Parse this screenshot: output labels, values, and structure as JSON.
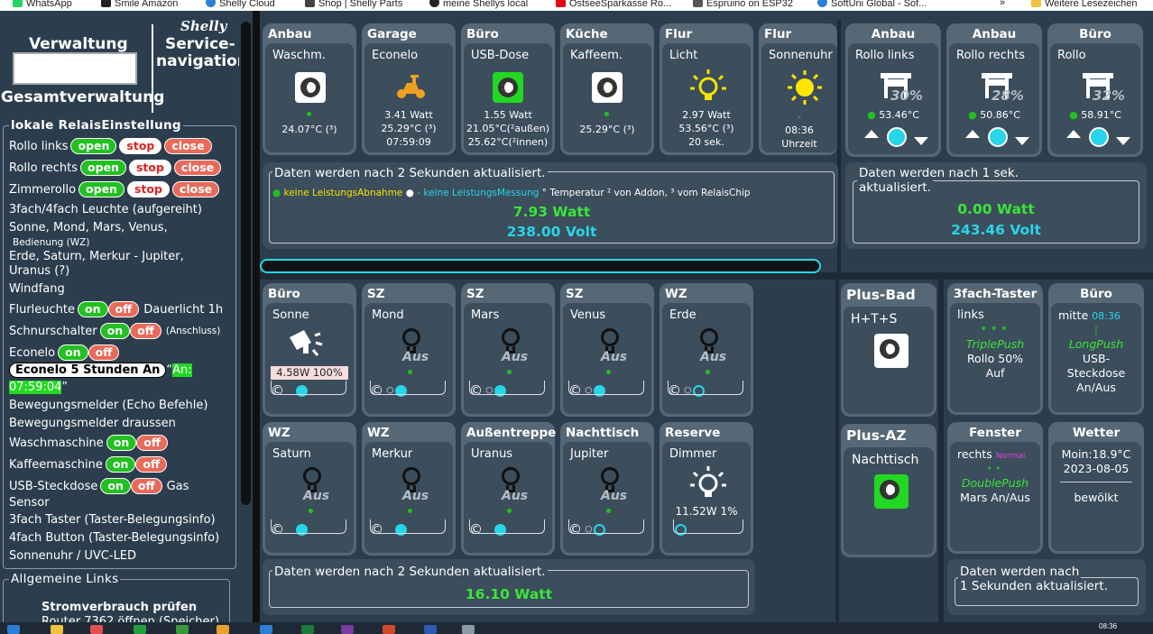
{
  "bookmarks": [
    {
      "label": "WhatsApp",
      "icon": "whatsapp-icon",
      "color": "#25d366"
    },
    {
      "label": "Smile Amazon",
      "icon": "amazon-icon",
      "color": "#222222"
    },
    {
      "label": "Shelly Cloud",
      "icon": "shelly-icon",
      "color": "#2b7fd4"
    },
    {
      "label": "Shop | Shelly Parts",
      "icon": "shop-icon",
      "color": "#444444"
    },
    {
      "label": "meine Shellys local",
      "icon": "spider-icon",
      "color": "#222222"
    },
    {
      "label": "OstseeSparkasse Ro...",
      "icon": "sparkasse-icon",
      "color": "#e30613"
    },
    {
      "label": "Espruino on ESP32",
      "icon": "espruino-icon",
      "color": "#555555"
    },
    {
      "label": "SoftUni Global - Sof...",
      "icon": "softuni-icon",
      "color": "#2b7fd4"
    },
    {
      "label": "»",
      "icon": "more-icon",
      "color": "#ffffff"
    },
    {
      "label": "Weitere Lesezeichen",
      "icon": "folder-icon",
      "color": "#f0c040"
    }
  ],
  "left": {
    "verwaltung": "Verwaltung",
    "shelly_logo": "Shelly",
    "service": "Service-",
    "navigation": "navigation",
    "gesamt": "Gesamtverwaltung",
    "lokal_title": "lokale RelaisEinstellung",
    "rollo_links": "Rollo links",
    "rollo_rechts": "Rollo rechts",
    "zimmerollo": "Zimmerollo",
    "open": "open",
    "stop": "stop",
    "close": "close",
    "leuchte": "3fach/4fach Leuchte (aufgereiht)",
    "sonne_line": "Sonne, Mond, Mars, Venus,",
    "bedienung": "Bedienung (WZ)",
    "erde_line": "Erde, Saturn, Merkur - Jupiter,",
    "uranus_line": "Uranus (?)",
    "windfang": "Windfang",
    "flurleuchte": "Flurleuchte",
    "dauerlicht": "Dauerlicht 1h",
    "schnurschalter": "Schnurschalter",
    "anschluss": "(Anschluss)",
    "econelo": "Econelo",
    "on": "on",
    "off": "off",
    "econelo5": "Econelo 5 Stunden An",
    "an_time_a": "An:",
    "an_time_b": "07:59:04",
    "bew_echo": "Bewegungsmelder (Echo Befehle)",
    "bew_draussen": "Bewegungsmelder draussen",
    "waschmaschine": "Waschmaschine",
    "kaffeemaschine": "Kaffeemaschine",
    "usb": "USB-Steckdose",
    "gas": "Gas",
    "sensor": "Sensor",
    "taster3": "3fach Taster (Taster-Belegungsinfo)",
    "button4": "4fach Button (Taster-Belegungsinfo)",
    "sonnenuhr": "Sonnenuhr / UVC-LED",
    "allgemein": "Allgemeine Links",
    "strom": "Stromverbrauch prüfen",
    "router": "Router 7362 öffnen (Speicher)"
  },
  "top_cards": [
    {
      "room": "Anbau",
      "name": "Waschm.",
      "l1": "24.07°C (³)"
    },
    {
      "room": "Garage",
      "name": "Econelo",
      "l1": "3.41 Watt",
      "l2": "25.29°C (³)",
      "l3": "07:59:09"
    },
    {
      "room": "Büro",
      "name": "USB-Dose",
      "l1": "1.55 Watt",
      "l2": "21.05°C(²außen)",
      "l3": "25.62°C(²innen)"
    },
    {
      "room": "Küche",
      "name": "Kaffeem.",
      "l1": "25.29°C (³)"
    },
    {
      "room": "Flur",
      "name": "Licht",
      "l1": "2.97 Watt",
      "l2": "53.56°C (³)",
      "l3": "20 sek."
    },
    {
      "room": "Flur",
      "name": "Sonnenuhr",
      "l1": "-",
      "l2": "08:36",
      "l3": "Uhrzeit"
    }
  ],
  "top_info": {
    "title": "Daten werden nach 2 Sekunden aktualisiert.",
    "leg1": "keine LeistungsAbnahme",
    "leg2": "-",
    "leg3": "keine LeistungsMessung",
    "leg4": "° Temperatur ² von Addon, ³ vom RelaisChip",
    "watt": "7.93 Watt",
    "volt": "238.00 Volt"
  },
  "rollo_cards": [
    {
      "room": "Anbau",
      "name": "Rollo links",
      "pct": "30%",
      "temp": "53.46°C"
    },
    {
      "room": "Anbau",
      "name": "Rollo rechts",
      "pct": "28%",
      "temp": "50.86°C"
    },
    {
      "room": "Büro",
      "name": "Rollo",
      "pct": "32%",
      "temp": "58.91°C"
    }
  ],
  "rollo_info": {
    "title": "Daten werden nach 1 sek.",
    "title2": "aktualisiert.",
    "watt": "0.00 Watt",
    "volt": "243.46 Volt"
  },
  "light_cards": [
    {
      "room": "Büro",
      "name": "Sonne",
      "status": "4.58W 100%"
    },
    {
      "room": "SZ",
      "name": "Mond",
      "status": "Aus"
    },
    {
      "room": "SZ",
      "name": "Mars",
      "status": "Aus"
    },
    {
      "room": "SZ",
      "name": "Venus",
      "status": "Aus"
    },
    {
      "room": "WZ",
      "name": "Erde",
      "status": "Aus"
    },
    {
      "room": "WZ",
      "name": "Saturn",
      "status": "Aus"
    },
    {
      "room": "WZ",
      "name": "Merkur",
      "status": "Aus"
    },
    {
      "room": "Außentreppe",
      "name": "Uranus",
      "status": "Aus"
    },
    {
      "room": "Nachttisch",
      "name": "Jupiter",
      "status": "Aus"
    },
    {
      "room": "Reserve",
      "name": "Dimmer",
      "status": "11.52W 1%"
    }
  ],
  "light_info": {
    "title": "Daten werden nach 2 Sekunden aktualisiert.",
    "watt": "16.10 Watt"
  },
  "plus": [
    {
      "title": "Plus-Bad",
      "name": "H+T+S"
    },
    {
      "title": "Plus-AZ",
      "name": "Nachttisch"
    }
  ],
  "taster": [
    {
      "room": "3fach-Taster",
      "l1": "links",
      "push": "TriplePush",
      "l2": "Rollo 50%",
      "l3": "Auf"
    },
    {
      "room": "Büro",
      "l1": "mitte",
      "time": "08:36",
      "push": "LongPush",
      "l2": "USB-",
      "l3": "Steckdose",
      "l4": "An/Aus"
    },
    {
      "room": "Fenster",
      "l1": "rechts",
      "mode": "Normal",
      "push": "DoublePush",
      "l2": "Mars An/Aus"
    },
    {
      "room": "Wetter",
      "l1": "Moin:18.9°C",
      "l2": "2023-08-05",
      "l3": "bewölkt"
    }
  ],
  "taster_info": {
    "title": "Daten werden nach",
    "title2": "1 Sekunden aktualisiert."
  },
  "clock": "08:36"
}
